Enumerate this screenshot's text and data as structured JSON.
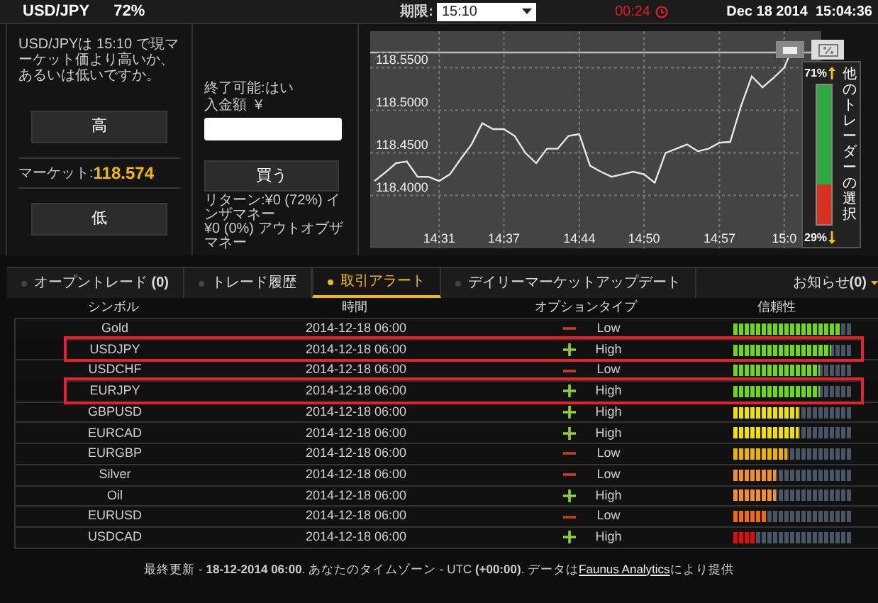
{
  "top_bar": {
    "pair": "USD/JPY",
    "payout": "72%",
    "expiry_label": "期限:",
    "expiry_value": "15:10",
    "countdown": "00:24",
    "datetime": "Dec 18 2014  15:04:36"
  },
  "trade_panel": {
    "question": "USD/JPYは 15:10 で現マーケット価より高いか、あるいは低いですか。",
    "high_button": "高",
    "market_label": "マーケット:",
    "market_value": "118.574",
    "low_button": "低",
    "closable": "終了可能:はい",
    "amount_label": "入金額  ¥",
    "buy_button": "買う",
    "return_in": "リターン:¥0 (72%) インザマネー",
    "return_out": "¥0 (0%) アウトオブザマネー"
  },
  "chart": {
    "chart_data": {
      "type": "line",
      "categories": [
        null,
        null,
        null,
        null,
        null,
        null,
        "14:31",
        null,
        null,
        null,
        null,
        null,
        "14:37",
        null,
        null,
        null,
        null,
        null,
        null,
        "14:44",
        null,
        null,
        null,
        null,
        null,
        "14:50",
        null,
        null,
        null,
        null,
        null,
        null,
        "14:57",
        null,
        null,
        null,
        null,
        null,
        "15:0",
        null
      ],
      "series": [
        {
          "color": "#e6e6e6",
          "values": [
            118.417,
            118.427,
            118.438,
            118.44,
            118.422,
            118.422,
            118.417,
            118.425,
            118.443,
            118.46,
            118.485,
            118.478,
            118.478,
            118.47,
            118.45,
            118.438,
            118.455,
            118.455,
            118.47,
            118.472,
            118.435,
            118.428,
            118.422,
            118.425,
            118.428,
            118.425,
            118.415,
            118.45,
            118.455,
            118.46,
            118.452,
            118.455,
            118.462,
            118.463,
            118.505,
            118.54,
            118.527,
            118.538,
            118.55,
            118.58
          ]
        }
      ],
      "ylim": [
        118.338,
        118.593
      ],
      "grid": true,
      "ref_lines": [
        {
          "axis": "y",
          "value": 118.568,
          "color": "#bbbbbb"
        }
      ],
      "yticks": [
        {
          "value": 118.55,
          "label": "118.5500"
        },
        {
          "value": 118.5,
          "label": "118.5000"
        },
        {
          "value": 118.45,
          "label": "118.4500"
        },
        {
          "value": 118.4,
          "label": "118.4000"
        }
      ]
    },
    "sentiment": {
      "up_share": "71%",
      "down_share": "29%",
      "level": 0.71,
      "caption": "他のトレーダーの選択"
    }
  },
  "tabs": [
    {
      "label": "オープントレード **(0)**",
      "selected": false
    },
    {
      "label": "トレード履歴",
      "selected": false
    },
    {
      "label": "取引アラート",
      "selected": true
    },
    {
      "label": "デイリーマーケットアップデート",
      "selected": false
    }
  ],
  "notifications": "お知らせ**(0)**",
  "table": {
    "columns": [
      "シンボル",
      "時間",
      "オプションタイプ",
      "信頼性"
    ],
    "rows": [
      {
        "symbol": "Gold",
        "time": "2014-12-18 06:00",
        "kind": "down",
        "type": "Low",
        "level": 0.9,
        "highlighted": false
      },
      {
        "symbol": "USDJPY",
        "time": "2014-12-18 06:00",
        "kind": "up",
        "type": "High",
        "level": 0.82,
        "highlighted": true
      },
      {
        "symbol": "USDCHF",
        "time": "2014-12-18 06:00",
        "kind": "down",
        "type": "Low",
        "level": 0.73,
        "highlighted": false
      },
      {
        "symbol": "EURJPY",
        "time": "2014-12-18 06:00",
        "kind": "up",
        "type": "High",
        "level": 0.73,
        "highlighted": true
      },
      {
        "symbol": "GBPUSD",
        "time": "2014-12-18 06:00",
        "kind": "up",
        "type": "High",
        "level": 0.55,
        "highlighted": false
      },
      {
        "symbol": "EURCAD",
        "time": "2014-12-18 06:00",
        "kind": "up",
        "type": "High",
        "level": 0.55,
        "highlighted": false
      },
      {
        "symbol": "EURGBP",
        "time": "2014-12-18 06:00",
        "kind": "down",
        "type": "Low",
        "level": 0.45,
        "highlighted": false
      },
      {
        "symbol": "Silver",
        "time": "2014-12-18 06:00",
        "kind": "down",
        "type": "Low",
        "level": 0.36,
        "highlighted": false
      },
      {
        "symbol": "Oil",
        "time": "2014-12-18 06:00",
        "kind": "up",
        "type": "High",
        "level": 0.36,
        "highlighted": false
      },
      {
        "symbol": "EURUSD",
        "time": "2014-12-18 06:00",
        "kind": "down",
        "type": "Low",
        "level": 0.27,
        "highlighted": false
      },
      {
        "symbol": "USDCAD",
        "time": "2014-12-18 06:00",
        "kind": "up",
        "type": "High",
        "level": 0.18,
        "highlighted": false
      }
    ]
  },
  "footer": {
    "text": "最終更新 - **18-12-2014 06:00**. あなたのタイムゾーン - UTC **(+00:00)**. データは",
    "link": "Faunus Analytics",
    "text_after": "により提供"
  }
}
